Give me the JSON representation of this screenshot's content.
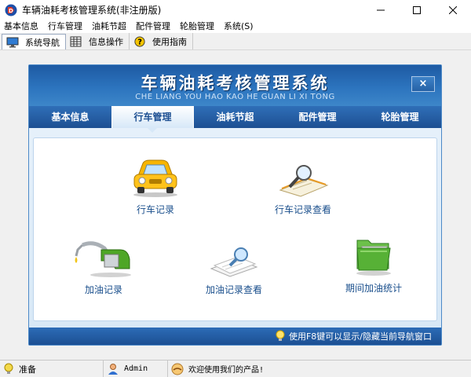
{
  "window": {
    "title": "车辆油耗考核管理系统(非注册版)",
    "controls": {
      "minimize": "─",
      "maximize": "☐",
      "close": "✕"
    }
  },
  "menu": [
    "基本信息",
    "行车管理",
    "油耗节超",
    "配件管理",
    "轮胎管理",
    "系统(S)"
  ],
  "toolbar": {
    "tabs": [
      {
        "label": "系统导航",
        "icon": "monitor-icon"
      },
      {
        "label": "信息操作",
        "icon": "grid-icon"
      },
      {
        "label": "使用指南",
        "icon": "help-icon"
      }
    ]
  },
  "panel": {
    "title": "车辆油耗考核管理系统",
    "subtitle": "CHE LIANG YOU HAO KAO HE  GUAN  LI XI TONG",
    "close_label": "×",
    "tabs": [
      "基本信息",
      "行车管理",
      "油耗节超",
      "配件管理",
      "轮胎管理"
    ],
    "active_tab": "行车管理",
    "items": [
      {
        "label": "行车记录",
        "icon": "car-icon"
      },
      {
        "label": "行车记录查看",
        "icon": "magnifier-document-icon"
      },
      {
        "label": "加油记录",
        "icon": "fuel-nozzle-icon"
      },
      {
        "label": "加油记录查看",
        "icon": "search-papers-icon"
      },
      {
        "label": "期间加油统计",
        "icon": "green-folder-icon"
      }
    ],
    "footer_tip": "使用F8键可以显示/隐藏当前导航窗口"
  },
  "statusbar": {
    "status": "准备",
    "user": "Admin",
    "message": "欢迎使用我们的产品!"
  },
  "colors": {
    "accent": "#1e5aa3",
    "label": "#1a4f8c"
  }
}
